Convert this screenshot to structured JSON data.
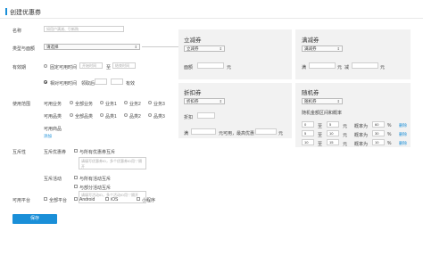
{
  "page_title": "创建优惠券",
  "form": {
    "name_label": "名称",
    "name_placeholder": "如用户满减、引新购",
    "type_label": "类型与面额",
    "type_select": "请选择",
    "validity_label": "有效期",
    "fixed_time_label": "固定可用时间",
    "start_placeholder": "开始时间",
    "to_label": "至",
    "end_placeholder": "结束时间",
    "relative_time_label": "相对可用时间",
    "receive_after_label": "领取后",
    "valid_days_label": "有效",
    "scope_label": "使用范围",
    "available_shops_label": "可用业务",
    "shop_options": [
      "全部业务",
      "业务1",
      "业务2",
      "业务3"
    ],
    "available_products_label": "可用品类",
    "product_options": [
      "全部品类",
      "品类1",
      "品类2",
      "品类3"
    ],
    "available_goods_label": "可用商品",
    "add_link": "添加",
    "mutex_label": "互斥性",
    "mutex_coupon_label": "互斥优惠券",
    "mutex_coupon_option": "与所有优惠券互斥",
    "mutex_coupon_placeholder": "请填写优惠券ID，多个优惠券ID用\",\"隔开",
    "mutex_activity_label": "互斥活动",
    "mutex_activity_option": "与所有活动互斥",
    "mutex_activity_option2": "与部分活动互斥",
    "mutex_activity_placeholder": "请填写活动ID，多个活动ID用\",\"隔开",
    "platform_label": "可用平台",
    "platform_options": [
      "全部平台",
      "Android",
      "iOS",
      "小程序"
    ],
    "save_button": "保存"
  },
  "panels": {
    "lijian": {
      "title": "立减券",
      "select": "立减券",
      "face_label": "面额",
      "unit": "元"
    },
    "manjian": {
      "title": "满减券",
      "select": "满减券",
      "man": "满",
      "unit1": "元",
      "jian": "减",
      "unit2": "元"
    },
    "zhekou": {
      "title": "折扣券",
      "select": "折扣券",
      "discount_label": "折扣",
      "man": "满",
      "mid_text": "元可用，最高优惠",
      "unit": "元"
    },
    "suiji": {
      "title": "随机券",
      "select": "随机券",
      "subtitle": "随机金额区间和概率",
      "rows": [
        {
          "from": "0",
          "to_label": "至",
          "to": "5",
          "unit": "元",
          "prob_label": "概率为",
          "prob": "60",
          "pct": "%",
          "del": "删除"
        },
        {
          "from": "5",
          "to_label": "至",
          "to": "10",
          "unit": "元",
          "prob_label": "概率为",
          "prob": "30",
          "pct": "%",
          "del": "删除"
        },
        {
          "from": "10",
          "to_label": "至",
          "to": "15",
          "unit": "元",
          "prob_label": "概率为",
          "prob": "10",
          "pct": "%",
          "del": "删除"
        }
      ]
    }
  }
}
